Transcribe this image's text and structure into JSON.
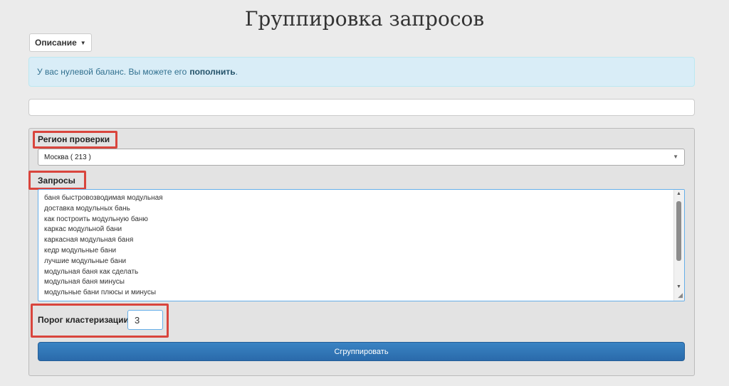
{
  "page": {
    "title": "Группировка запросов"
  },
  "description_button": {
    "label": "Описание"
  },
  "alert": {
    "text": "У вас нулевой баланс. Вы можете его",
    "link": "пополнить",
    "suffix": "."
  },
  "form": {
    "region_label": "Регион проверки",
    "region_value": "Москва ( 213 )",
    "queries_label": "Запросы",
    "queries": [
      "баня быстровозводимая модульная",
      "доставка модульных бань",
      "как построить модульную баню",
      "каркас модульной бани",
      "каркасная модульная баня",
      "кедр модульные бани",
      "лучшие модульные бани",
      "модульная баня как сделать",
      "модульная баня минусы",
      "модульные бани плюсы и минусы"
    ],
    "threshold_label": "Порог кластеризации",
    "threshold_value": "3",
    "submit_label": "Сгруппировать"
  },
  "colors": {
    "highlight": "#d9453d",
    "button": "#337ab7",
    "alert_bg": "#d9edf7"
  }
}
